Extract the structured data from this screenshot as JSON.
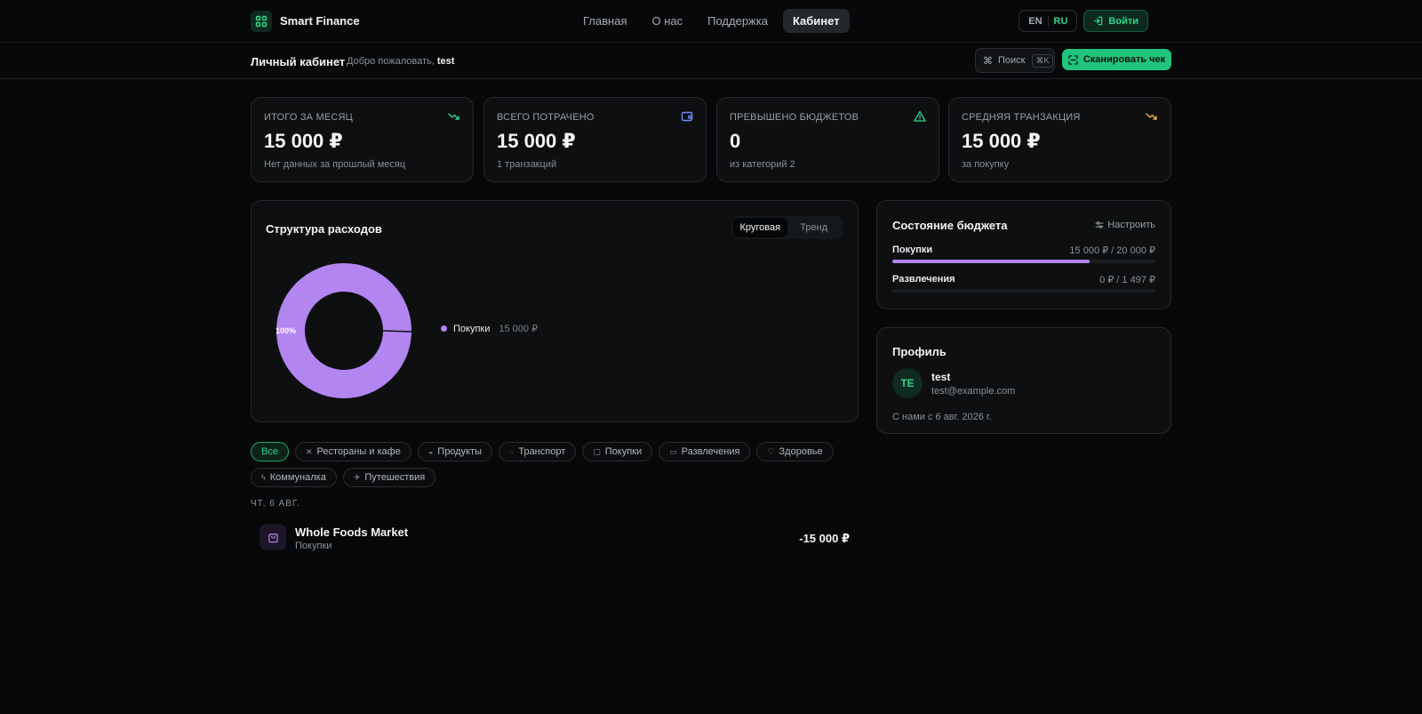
{
  "brand": {
    "name": "Smart Finance",
    "icon": "grid-icon"
  },
  "nav": {
    "links": [
      "Главная",
      "О нас",
      "Поддержка",
      "Кабинет"
    ],
    "active": "Кабинет"
  },
  "lang": {
    "en": "EN",
    "ru": "RU",
    "active": "RU"
  },
  "login": {
    "label": "Войти",
    "icon": "login-icon"
  },
  "subbar": {
    "title": "Личный кабинет",
    "welcome": "Добро пожаловать,",
    "user": "test",
    "search_label": "Поиск",
    "search_kbd": "⌘K",
    "scan_label": "Сканировать чек"
  },
  "stats": [
    {
      "label": "ИТОГО ЗА МЕСЯЦ",
      "value": "15 000 ₽",
      "sub": "Нет данных за прошлый месяц",
      "icon": "trending-down-icon",
      "icon_color": "#2fd58a"
    },
    {
      "label": "ВСЕГО ПОТРАЧЕНО",
      "value": "15 000 ₽",
      "sub": "1 транзакций",
      "icon": "wallet-icon",
      "icon_color": "#6b8cff"
    },
    {
      "label": "ПРЕВЫШЕНО БЮДЖЕТОВ",
      "value": "0",
      "sub": "из категорий 2",
      "icon": "warning-icon",
      "icon_color": "#2fd58a"
    },
    {
      "label": "СРЕДНЯЯ ТРАНЗАКЦИЯ",
      "value": "15 000 ₽",
      "sub": "за покупку",
      "icon": "trending-down-icon",
      "icon_color": "#f5b041"
    }
  ],
  "chart": {
    "title": "Структура расходов",
    "toggle": [
      "Круговая",
      "Тренд"
    ],
    "toggle_active": "Круговая",
    "legend_value": "15 000 ₽"
  },
  "chart_data": {
    "type": "pie",
    "slices": [
      {
        "name": "Покупки",
        "value": 15000,
        "percent": 100,
        "label": "100%",
        "color": "#b285f0"
      }
    ]
  },
  "budget": {
    "title": "Состояние бюджета",
    "config_label": "Настроить",
    "rows": [
      {
        "label": "Покупки",
        "value": "15 000 ₽ / 20 000 ₽",
        "fill": 0.75
      },
      {
        "label": "Развлечения",
        "value": "0 ₽ / 1 497 ₽",
        "fill": 0
      }
    ]
  },
  "profile": {
    "title": "Профиль",
    "initials": "TE",
    "name": "test",
    "email": "test@example.com",
    "since": "С нами с 6 авг. 2026 г."
  },
  "filters": [
    {
      "label": "Все",
      "icon": "",
      "active": true
    },
    {
      "label": "Рестораны и кафе",
      "icon": "utensils-icon"
    },
    {
      "label": "Продукты",
      "icon": "basket-icon"
    },
    {
      "label": "Транспорт",
      "icon": "car-icon"
    },
    {
      "label": "Покупки",
      "icon": "bag-icon"
    },
    {
      "label": "Развлечения",
      "icon": "ticket-icon"
    },
    {
      "label": "Здоровье",
      "icon": "heart-icon"
    },
    {
      "label": "Коммуналка",
      "icon": "bolt-icon"
    },
    {
      "label": "Путешествия",
      "icon": "plane-icon"
    }
  ],
  "transactions": {
    "date_header": "ЧТ, 6 АВГ.",
    "items": [
      {
        "name": "Whole Foods Market",
        "category": "Покупки",
        "amount": "-15 000 ₽",
        "icon": "bag-icon"
      }
    ]
  },
  "colors": {
    "accent": "#21c47d",
    "purple": "#b285f0",
    "background": "#070809"
  }
}
